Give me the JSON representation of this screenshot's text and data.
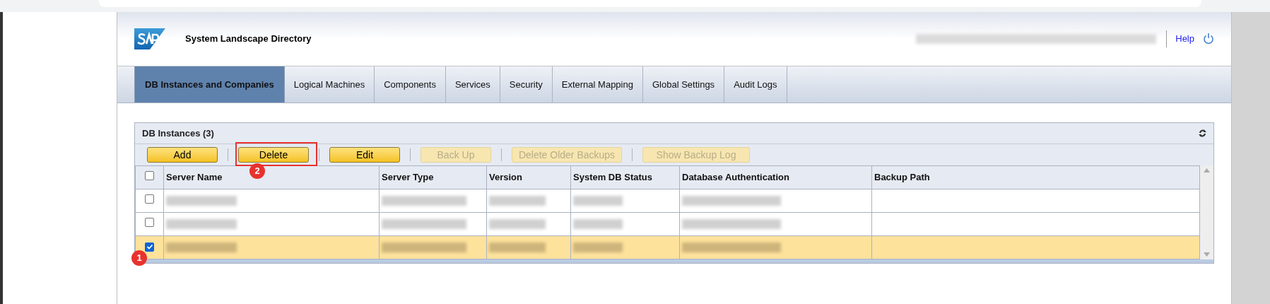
{
  "header": {
    "title": "System Landscape Directory",
    "help_link": "Help"
  },
  "tabs": [
    {
      "label": "DB Instances and Companies",
      "selected": true
    },
    {
      "label": "Logical Machines",
      "selected": false
    },
    {
      "label": "Components",
      "selected": false
    },
    {
      "label": "Services",
      "selected": false
    },
    {
      "label": "Security",
      "selected": false
    },
    {
      "label": "External Mapping",
      "selected": false
    },
    {
      "label": "Global Settings",
      "selected": false
    },
    {
      "label": "Audit Logs",
      "selected": false
    }
  ],
  "panel": {
    "title": "DB Instances (3)",
    "toolbar": [
      {
        "label": "Add",
        "disabled": false
      },
      {
        "label": "Delete",
        "disabled": false,
        "highlighted": true,
        "annotation": "2"
      },
      {
        "label": "Edit",
        "disabled": false
      },
      {
        "label": "Back Up",
        "disabled": true
      },
      {
        "label": "Delete Older Backups",
        "disabled": true
      },
      {
        "label": "Show Backup Log",
        "disabled": true
      }
    ],
    "select_all_checked": false,
    "columns": [
      "Server Name",
      "Server Type",
      "Version",
      "System DB Status",
      "Database Authentication",
      "Backup Path"
    ],
    "rows": [
      {
        "checked": false
      },
      {
        "checked": false
      },
      {
        "checked": true,
        "annotation": "1"
      }
    ]
  }
}
